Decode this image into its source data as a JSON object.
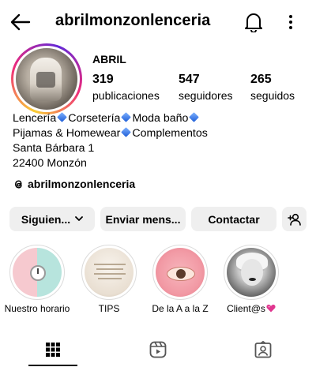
{
  "header": {
    "username": "abrilmonzonlenceria",
    "back_icon": "arrow-left-icon",
    "notifications_icon": "bell-icon",
    "more_icon": "more-vertical-icon"
  },
  "profile": {
    "display_name": "ABRIL",
    "stats": {
      "posts_count": "319",
      "posts_label": "publicaciones",
      "followers_count": "547",
      "followers_label": "seguidores",
      "following_count": "265",
      "following_label": "seguidos"
    },
    "bio": {
      "line1_a": "Lencería",
      "line1_b": "Corsetería",
      "line1_c": "Moda baño",
      "line2_a": "Pijamas & Homewear",
      "line2_b": "Complementos",
      "line3": "Santa Bárbara 1",
      "line4": "22400 Monzón"
    },
    "threads_handle": "abrilmonzonlenceria"
  },
  "actions": {
    "following_label": "Siguien...",
    "message_label": "Enviar mens...",
    "contact_label": "Contactar"
  },
  "highlights": [
    {
      "label": "Nuestro horario"
    },
    {
      "label": "TIPS"
    },
    {
      "label": "De la A a la Z"
    },
    {
      "label": "Client@s"
    }
  ],
  "tabs": {
    "active": "grid"
  },
  "colors": {
    "button_bg": "#efefef",
    "ring_gradient": [
      "#f9ce34",
      "#ee2a7b",
      "#6228d7"
    ],
    "diamond_blue": "#1c5cd6",
    "heart_pink": "#e0368f"
  }
}
